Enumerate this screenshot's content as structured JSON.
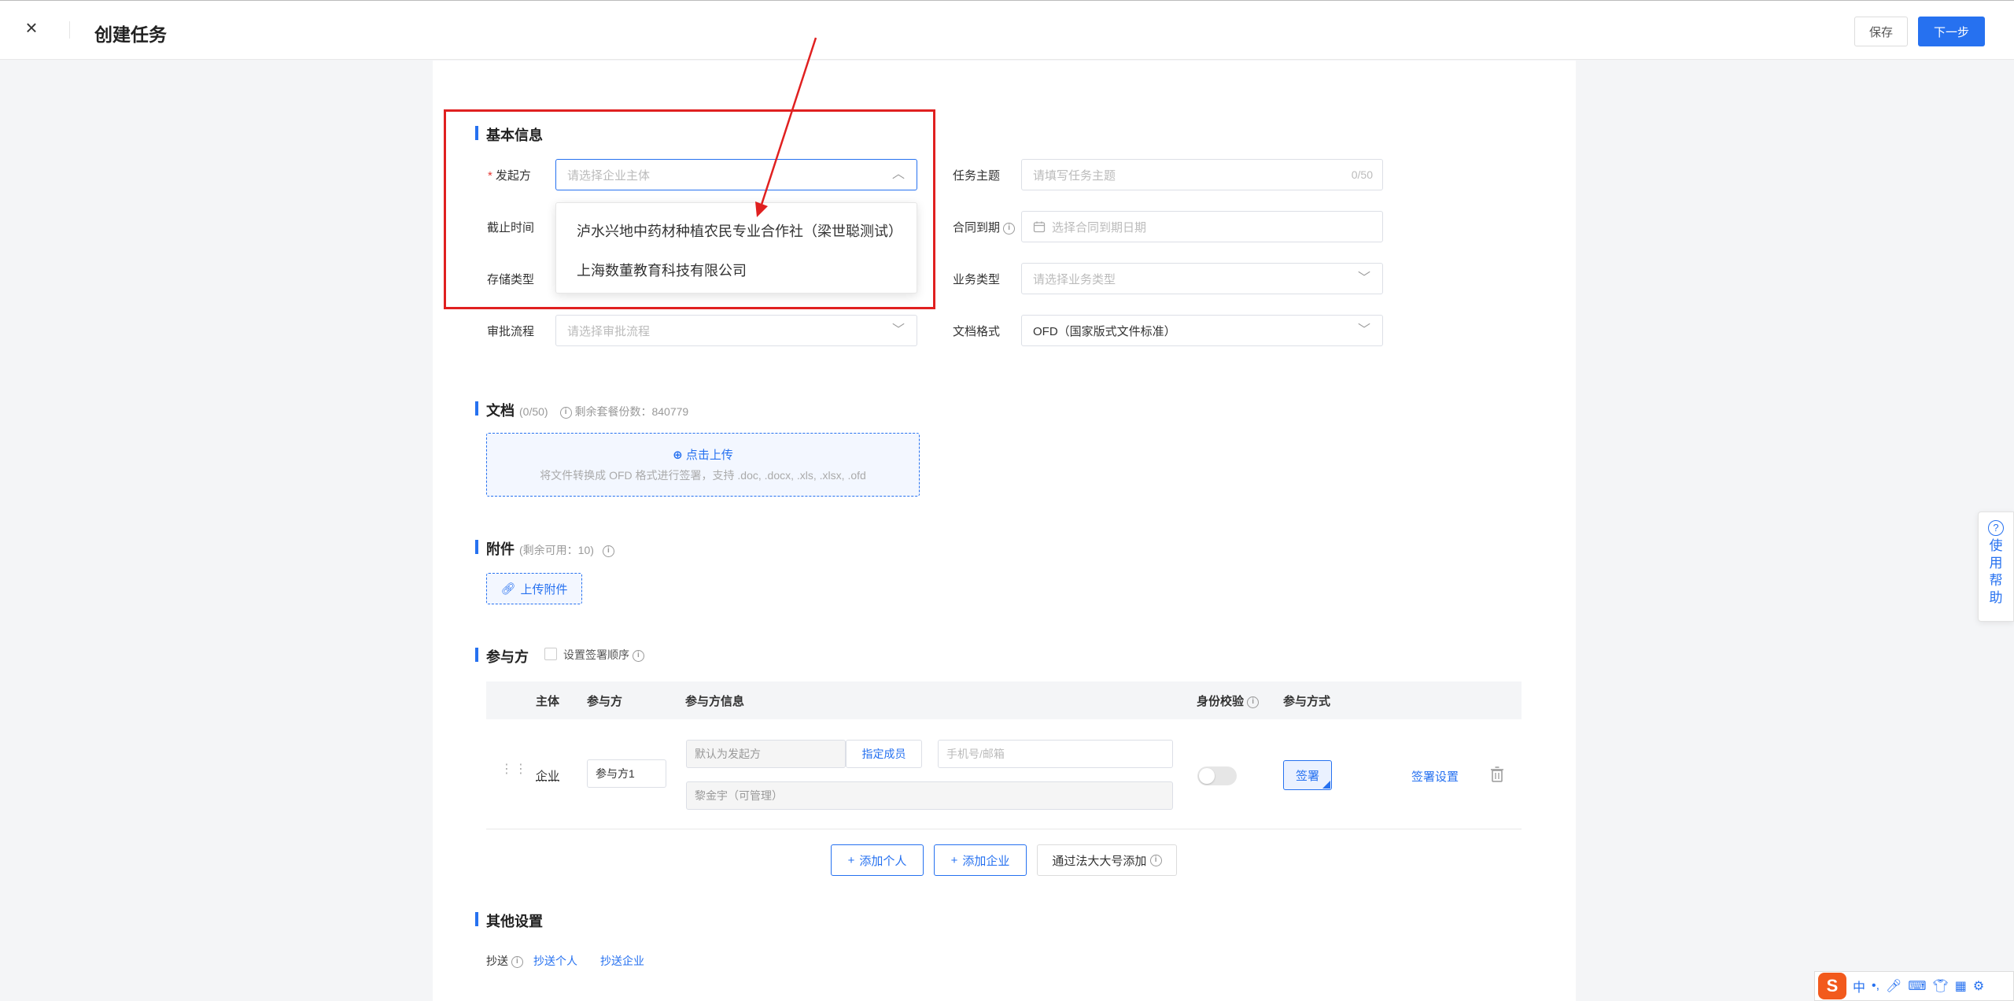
{
  "header": {
    "title": "创建任务",
    "close_icon": "close-icon",
    "save_label": "保存",
    "next_label": "下一步"
  },
  "basic": {
    "section_title": "基本信息",
    "initiator": {
      "required_mark": "*",
      "label": "发起方",
      "placeholder": "请选择企业主体"
    },
    "deadline": {
      "label": "截止时间"
    },
    "storage": {
      "label": "存储类型"
    },
    "approval": {
      "label": "审批流程",
      "placeholder": "请选择审批流程"
    },
    "subject": {
      "label": "任务主题",
      "placeholder": "请填写任务主题",
      "counter": "0/50"
    },
    "contract_expiry": {
      "label": "合同到期",
      "placeholder": "选择合同到期日期"
    },
    "business_type": {
      "label": "业务类型",
      "placeholder": "请选择业务类型"
    },
    "doc_format": {
      "label": "文档格式",
      "value": "OFD（国家版式文件标准）"
    }
  },
  "initiator_dropdown": {
    "options": [
      "泸水兴地中药材种植农民专业合作社（梁世聪测试）",
      "上海数董教育科技有限公司"
    ]
  },
  "documents": {
    "section_title": "文档",
    "count": "(0/50)",
    "remaining": "剩余套餐份数：840779",
    "upload_link": "点击上传",
    "upload_hint": "将文件转换成 OFD 格式进行签署，支持 .doc, .docx, .xls, .xlsx, .ofd"
  },
  "attachments": {
    "section_title": "附件",
    "remaining": "(剩余可用：10)",
    "upload_button": "上传附件"
  },
  "participants": {
    "section_title": "参与方",
    "set_order_label": "设置签署顺序",
    "columns": [
      "主体",
      "参与方",
      "参与方信息",
      "身份校验",
      "参与方式"
    ],
    "row": {
      "entity": "企业",
      "name": "参与方1",
      "company_placeholder": "默认为发起方",
      "assign_member": "指定成员",
      "contact_placeholder": "手机号/邮箱",
      "member": "黎金宇（可管理）",
      "identity_check": false,
      "method": "签署",
      "settings_link": "签署设置"
    },
    "add_person": "添加个人",
    "add_company": "添加企业",
    "add_by_legal": "通过法大大号添加"
  },
  "other": {
    "section_title": "其他设置",
    "cc_label": "抄送",
    "cc_person": "抄送个人",
    "cc_company": "抄送企业"
  },
  "help": {
    "q_mark": "?",
    "chars": [
      "使",
      "用",
      "帮",
      "助"
    ]
  },
  "ime": {
    "logo": "S",
    "mode": "中",
    "punct": "•,"
  }
}
